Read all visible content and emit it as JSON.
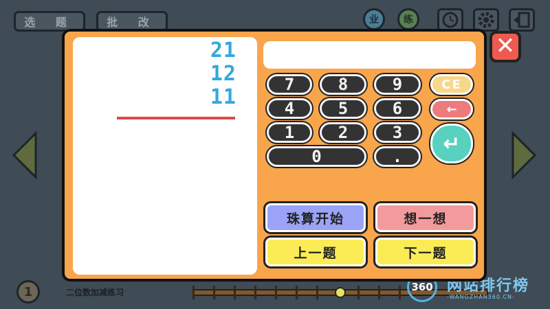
{
  "background": {
    "tabs": [
      "选 题",
      "批 改"
    ],
    "round_buttons": [
      "业",
      "练"
    ],
    "question_number": "1",
    "bottom_label": "二位数加减练习",
    "slider_value": 0.5
  },
  "problem": {
    "operand_1": "21",
    "operand_2": "12",
    "operand_3": "11"
  },
  "display": {
    "value": ""
  },
  "keypad": {
    "keys": [
      "7",
      "8",
      "9",
      "4",
      "5",
      "6",
      "1",
      "2",
      "3",
      "0",
      "."
    ],
    "clear_label": "CE",
    "back_label": "←",
    "enter_label": "↵"
  },
  "actions": {
    "abacus_start": "珠算开始",
    "think": "想一想",
    "previous": "上一题",
    "next": "下一题"
  },
  "watermark": {
    "logo": "360",
    "title": "网站排行榜",
    "subtitle": "-WANGZHAN360.CN-"
  },
  "colors": {
    "dialog_bg": "#f8a54c",
    "number_blue": "#34a8dc",
    "line_red": "#e04848",
    "btn_purple": "#9aa3f5",
    "btn_pink": "#f39a9c",
    "btn_yellow": "#fbec55",
    "enter_teal": "#58d1be"
  }
}
